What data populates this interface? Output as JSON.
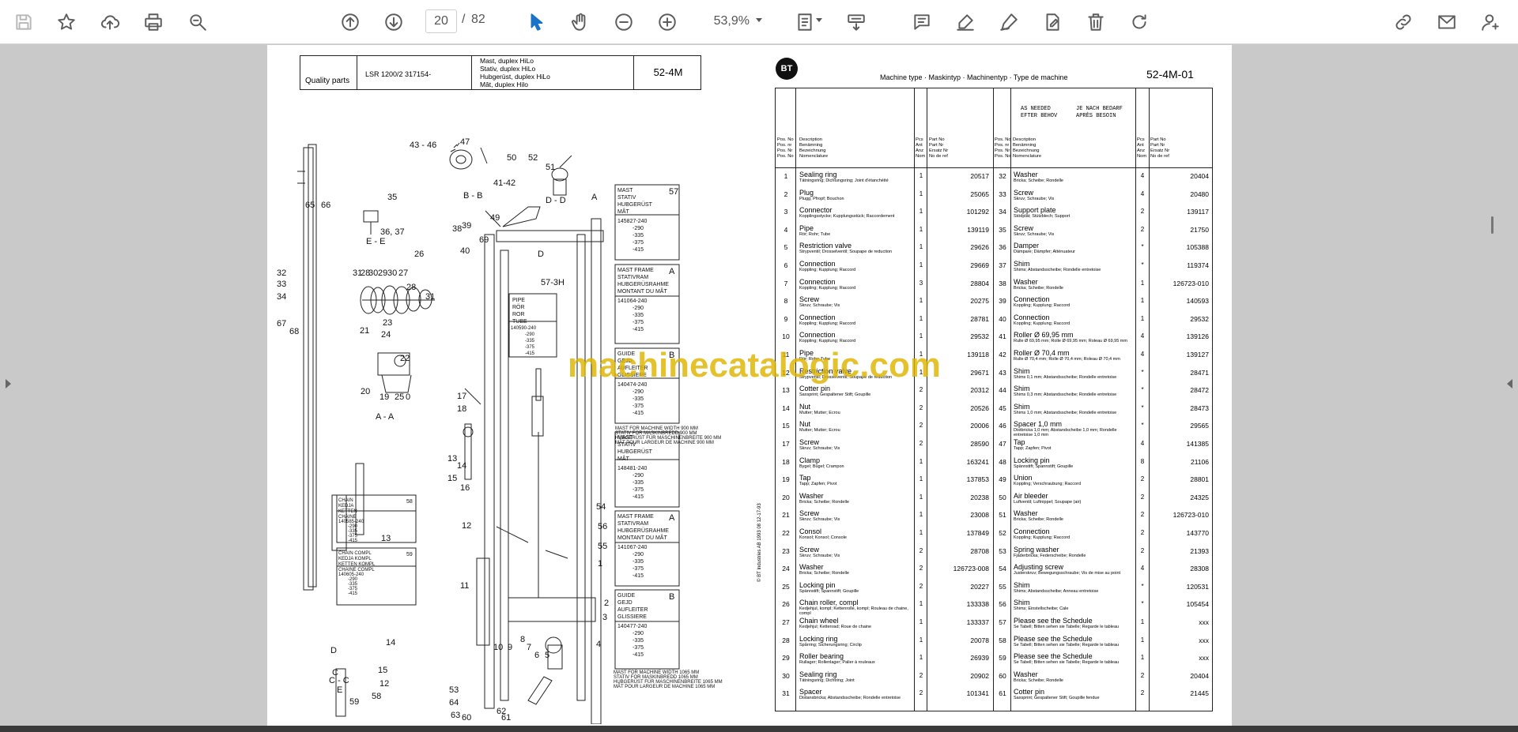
{
  "toolbar": {
    "buttons": [
      "save-icon",
      "bookmark-star-icon",
      "upload-cloud-icon",
      "print-icon",
      "zoom-search-icon",
      "page-up-icon",
      "page-down-icon",
      "select-arrow-icon",
      "hand-pan-icon",
      "zoom-out-icon",
      "zoom-in-icon",
      "fit-page-icon",
      "scroll-mode-icon",
      "comment-icon",
      "highlight-pen-icon",
      "sign-icon",
      "edit-pdf-icon",
      "delete-icon",
      "redo-icon",
      "share-link-icon",
      "email-icon",
      "account-icon"
    ],
    "page_current": "20",
    "page_separator": "/",
    "page_total": "82",
    "zoom": "53,9%"
  },
  "left_page": {
    "header": {
      "brand": "Quality parts",
      "model": "LSR 1200/2 317154-",
      "title_lines": [
        "Mast, duplex HiLo",
        "Stativ, duplex HiLo",
        "Hubgerüst, duplex HiLo",
        "Mât, duplex Hilo"
      ],
      "code": "52-4M"
    },
    "callouts": [
      "43 - 46",
      "47",
      "50",
      "52",
      "51",
      "41-42",
      "B - B",
      "D - D",
      "A",
      "35",
      "65",
      "66",
      "36, 37",
      "E - E",
      "26",
      "31",
      "28",
      "30",
      "29",
      "30",
      "27",
      "28",
      "31",
      "32",
      "33",
      "34",
      "67",
      "68",
      "23",
      "24",
      "21",
      "22",
      "20",
      "19",
      "25",
      "0",
      "A - A",
      "38",
      "39",
      "49",
      "69",
      "40",
      "D",
      "57-3H",
      "17",
      "18",
      "13",
      "14",
      "15",
      "16",
      "12",
      "11",
      "10",
      "9",
      "8",
      "7",
      "6",
      "5",
      "4",
      "3",
      "2",
      "1",
      "55",
      "56",
      "54",
      "53",
      "64",
      "63",
      "60",
      "61",
      "62",
      "13",
      "14",
      "15",
      "12",
      "58",
      "59",
      "E",
      "C",
      "C - C",
      "D"
    ],
    "boxes": [
      {
        "lines": [
          "MAST",
          "STATIV",
          "HUBGERÜST",
          "MÂT"
        ],
        "num": "57",
        "values": [
          "145827-240",
          "-290",
          "-335",
          "-375",
          "-415"
        ]
      },
      {
        "lines": [
          "MAST FRAME",
          "STATIVRAM",
          "HUBGERÜSRAHME",
          "MONTANT DU MÂT"
        ],
        "num": "A",
        "values": [
          "141064-240",
          "-290",
          "-335",
          "-375",
          "-415"
        ]
      },
      {
        "lines": [
          "GUIDE",
          "GEJD",
          "AUFLEITER",
          "GLISSIERE"
        ],
        "num": "B",
        "values": [
          "140474-240",
          "-290",
          "-335",
          "-375",
          "-415"
        ]
      },
      {
        "lines": [
          "MAST",
          "STATIV",
          "HUBGERÜST",
          "MÂT"
        ],
        "num": "",
        "values": [
          "148481-240",
          "-290",
          "-335",
          "-375",
          "-415"
        ]
      },
      {
        "lines": [
          "MAST FRAME",
          "STATIVRAM",
          "HUBGERÜSRAHME",
          "MONTANT DU MÂT"
        ],
        "num": "A",
        "values": [
          "141067-240",
          "-290",
          "-335",
          "-375",
          "-415"
        ]
      },
      {
        "lines": [
          "GUIDE",
          "GEJD",
          "AUFLEITER",
          "GLISSIERE"
        ],
        "num": "B",
        "values": [
          "140477-240",
          "-290",
          "-335",
          "-375",
          "-415"
        ]
      }
    ],
    "pipe_box": {
      "lines": [
        "PIPE",
        "RÖR",
        "ROR",
        "TUBE"
      ],
      "values": [
        "140590-240",
        "-290",
        "-335",
        "-375",
        "-415"
      ]
    },
    "notes": [
      "MAST FOR MACHINE WIDTH 900 MM",
      "STATIV FOR MASKINBREDD 900 MM",
      "HUBGERÜST FÜR MASCHINENBREITE 900 MM",
      "MÂT POUR LARGEUR DE MACHINE 900 MM",
      "MAST FOR MACHINE WIDTH 1065 MM",
      "STATIV FOR MASKINBREDD 1065 MM",
      "HUBGERÜST FÜR MASCHINENBREITE 1065 MM",
      "MÂT POUR LARGEUR DE MACHINE 1065 MM"
    ],
    "chain_box": {
      "lines": [
        "CHAIN",
        "KEDJA",
        "KETTEN",
        "CHAINE"
      ],
      "num": "58",
      "values": [
        "140585-240",
        "-290",
        "-335",
        "-375",
        "-415"
      ]
    },
    "chain_compl_box": {
      "lines": [
        "CHAIN COMPL",
        "KEDJA KOMPL",
        "KETTEN KOMPL",
        "CHAINE COMPL"
      ],
      "num": "59",
      "values": [
        "140605-240",
        "-290",
        "-335",
        "-375",
        "-415"
      ]
    }
  },
  "right_page": {
    "logo": "BT",
    "title": "Machine type · Maskintyp · Machinentyp · Type de machine",
    "code": "52-4M-01",
    "as_needed": [
      "AS NEEDED",
      "EFTER BEHOV"
    ],
    "je_nach": [
      "JE NACH BEDARF",
      "APRÈS BESOIN"
    ],
    "headers": {
      "pos": [
        "Pos. No",
        "Pos. nr",
        "Pos. Nr",
        "Pos. No"
      ],
      "desc": [
        "Description",
        "Benämning",
        "Bezeichnung",
        "Nomenclature"
      ],
      "qty": [
        "Pcs",
        "Ant",
        "Anz",
        "Nom"
      ],
      "part": [
        "Part No",
        "Part Nr",
        "Ersatz Nr",
        "No de ref"
      ]
    },
    "left_rows": [
      {
        "pos": "1",
        "name": "Sealing ring",
        "sub": "Tätningsring; Dichtungsring; Joint d'étanchéité",
        "qty": "1",
        "part": "20517"
      },
      {
        "pos": "2",
        "name": "Plug",
        "sub": "Plugg; Pfropf; Bouchon",
        "qty": "1",
        "part": "25065"
      },
      {
        "pos": "3",
        "name": "Connector",
        "sub": "Kopplingsstycke; Kupplungsstück; Raccordement",
        "qty": "1",
        "part": "101292"
      },
      {
        "pos": "4",
        "name": "Pipe",
        "sub": "Rör; Rohr; Tube",
        "qty": "1",
        "part": "139119"
      },
      {
        "pos": "5",
        "name": "Restriction valve",
        "sub": "Strypventil; Drosselventil; Soupape de reduction",
        "qty": "1",
        "part": "29626"
      },
      {
        "pos": "6",
        "name": "Connection",
        "sub": "Koppling; Kupplung; Raccord",
        "qty": "1",
        "part": "29669"
      },
      {
        "pos": "7",
        "name": "Connection",
        "sub": "Koppling; Kupplung; Raccord",
        "qty": "3",
        "part": "28804"
      },
      {
        "pos": "8",
        "name": "Screw",
        "sub": "Skruv; Schraube; Vis",
        "qty": "1",
        "part": "20275"
      },
      {
        "pos": "9",
        "name": "Connection",
        "sub": "Koppling; Kupplung; Raccord",
        "qty": "1",
        "part": "28781"
      },
      {
        "pos": "10",
        "name": "Connection",
        "sub": "Koppling; Kupplung; Raccord",
        "qty": "1",
        "part": "29532"
      },
      {
        "pos": "11",
        "name": "Pipe",
        "sub": "Rör; Rohr; Tube",
        "qty": "1",
        "part": "139118"
      },
      {
        "pos": "12",
        "name": "Restriction valve",
        "sub": "Strypventil; Drosselventil; Soupape de reduction",
        "qty": "1",
        "part": "29671"
      },
      {
        "pos": "13",
        "name": "Cotter pin",
        "sub": "Saxsprint; Gespaltener Stift; Goupille",
        "qty": "2",
        "part": "20312"
      },
      {
        "pos": "14",
        "name": "Nut",
        "sub": "Mutter; Mutter; Ecrou",
        "qty": "2",
        "part": "20526"
      },
      {
        "pos": "15",
        "name": "Nut",
        "sub": "Mutter; Mutter; Ecrou",
        "qty": "2",
        "part": "20006"
      },
      {
        "pos": "17",
        "name": "Screw",
        "sub": "Skruv; Schraube; Vis",
        "qty": "2",
        "part": "28590"
      },
      {
        "pos": "18",
        "name": "Clamp",
        "sub": "Bygel; Bügel; Crampon",
        "qty": "1",
        "part": "163241"
      },
      {
        "pos": "19",
        "name": "Tap",
        "sub": "Tapp; Zapfen; Pivot",
        "qty": "1",
        "part": "137853"
      },
      {
        "pos": "20",
        "name": "Washer",
        "sub": "Bricka; Scheibe; Rondelle",
        "qty": "1",
        "part": "20238"
      },
      {
        "pos": "21",
        "name": "Screw",
        "sub": "Skruv; Schraube; Vis",
        "qty": "1",
        "part": "23008"
      },
      {
        "pos": "22",
        "name": "Consol",
        "sub": "Konsol; Konsol; Console",
        "qty": "1",
        "part": "137849"
      },
      {
        "pos": "23",
        "name": "Screw",
        "sub": "Skruv; Schraube; Vis",
        "qty": "2",
        "part": "28708"
      },
      {
        "pos": "24",
        "name": "Washer",
        "sub": "Bricka; Scheibe; Rondelle",
        "qty": "2",
        "part": "126723-008"
      },
      {
        "pos": "25",
        "name": "Locking pin",
        "sub": "Spännstift; Spannstift; Goupille",
        "qty": "2",
        "part": "20227"
      },
      {
        "pos": "26",
        "name": "Chain roller, compl",
        "sub": "Kedjehjul, kompl; Kettenrolle, kompl; Rouleau de chaine, compl",
        "qty": "1",
        "part": "133338"
      },
      {
        "pos": "27",
        "name": "Chain wheel",
        "sub": "Kedjehjul; Kettenrad; Roue de chaine",
        "qty": "1",
        "part": "133337"
      },
      {
        "pos": "28",
        "name": "Locking ring",
        "sub": "Spårring; Sicherungsring; Circlip",
        "qty": "1",
        "part": "20078"
      },
      {
        "pos": "29",
        "name": "Roller bearing",
        "sub": "Rullager; Rollenlager; Palier à rouleaux",
        "qty": "1",
        "part": "26939"
      },
      {
        "pos": "30",
        "name": "Sealing ring",
        "sub": "Tätningsring; Dichtring; Joint",
        "qty": "2",
        "part": "20902"
      },
      {
        "pos": "31",
        "name": "Spacer",
        "sub": "Distansbricka; Abstandsscheibe; Rondelle entretoise",
        "qty": "2",
        "part": "101341"
      }
    ],
    "right_rows": [
      {
        "pos": "32",
        "name": "Washer",
        "sub": "Bricka; Scheibe; Rondelle",
        "qty": "4",
        "part": "20404"
      },
      {
        "pos": "33",
        "name": "Screw",
        "sub": "Skruv; Schraube; Vis",
        "qty": "4",
        "part": "20480"
      },
      {
        "pos": "34",
        "name": "Support plate",
        "sub": "Stödplåt; Stützblech; Support",
        "qty": "2",
        "part": "139117"
      },
      {
        "pos": "35",
        "name": "Screw",
        "sub": "Skruv; Schraube; Vis",
        "qty": "2",
        "part": "21750"
      },
      {
        "pos": "36",
        "name": "Damper",
        "sub": "Dämpare; Dämpfer; Atténuateur",
        "qty": "*",
        "part": "105388"
      },
      {
        "pos": "37",
        "name": "Shim",
        "sub": "Shims; Abstandsscheibe; Rondelle entretoise",
        "qty": "*",
        "part": "119374"
      },
      {
        "pos": "38",
        "name": "Washer",
        "sub": "Bricka; Scheibe; Rondelle",
        "qty": "1",
        "part": "126723-010"
      },
      {
        "pos": "39",
        "name": "Connection",
        "sub": "Koppling; Kupplung; Raccord",
        "qty": "1",
        "part": "140593"
      },
      {
        "pos": "40",
        "name": "Connection",
        "sub": "Koppling; Kupplung; Raccord",
        "qty": "1",
        "part": "29532"
      },
      {
        "pos": "41",
        "name": "Roller Ø 69,95 mm",
        "sub": "Rulle Ø 69,95 mm; Rolle Ø 69,95 mm; Roleau Ø 69,95 mm",
        "qty": "4",
        "part": "139126"
      },
      {
        "pos": "42",
        "name": "Roller Ø 70,4 mm",
        "sub": "Rulle Ø 70,4 mm; Rolle Ø 70,4 mm; Roleau Ø 70,4 mm",
        "qty": "4",
        "part": "139127"
      },
      {
        "pos": "43",
        "name": "Shim",
        "sub": "Shims 0,1 mm; Abstandsscheibe; Rondelle entretoise",
        "qty": "*",
        "part": "28471"
      },
      {
        "pos": "44",
        "name": "Shim",
        "sub": "Shims 0,3 mm; Abstandsscheibe; Rondelle entretoise",
        "qty": "*",
        "part": "28472"
      },
      {
        "pos": "45",
        "name": "Shim",
        "sub": "Shims 1,0 mm; Abstandsscheibe; Rondelle entretoise",
        "qty": "*",
        "part": "28473"
      },
      {
        "pos": "46",
        "name": "Spacer 1,0 mm",
        "sub": "Distbricka 1,0 mm; Abstandscheibe 1,0 mm; Rondelle entretoise 1,0 mm",
        "qty": "*",
        "part": "29565"
      },
      {
        "pos": "47",
        "name": "Tap",
        "sub": "Tapp; Zapfen; Pivot",
        "qty": "4",
        "part": "141385"
      },
      {
        "pos": "48",
        "name": "Locking pin",
        "sub": "Spännstift; Spannstift; Goupille",
        "qty": "8",
        "part": "21106"
      },
      {
        "pos": "49",
        "name": "Union",
        "sub": "Koppling; Verschraubung; Raccord",
        "qty": "2",
        "part": "28801"
      },
      {
        "pos": "50",
        "name": "Air bleeder",
        "sub": "Luftventil; Luftnippel; Soupape (air)",
        "qty": "2",
        "part": "24325"
      },
      {
        "pos": "51",
        "name": "Washer",
        "sub": "Bricka; Scheibe; Rondelle",
        "qty": "2",
        "part": "126723-010"
      },
      {
        "pos": "52",
        "name": "Connection",
        "sub": "Koppling; Kupplung; Raccord",
        "qty": "2",
        "part": "143770"
      },
      {
        "pos": "53",
        "name": "Spring washer",
        "sub": "Fjäderbricka; Federscheibe; Rondelle",
        "qty": "2",
        "part": "21393"
      },
      {
        "pos": "54",
        "name": "Adjusting screw",
        "sub": "Justerskruv; Bewegungsschraube; Vis de mise au point",
        "qty": "4",
        "part": "28308"
      },
      {
        "pos": "55",
        "name": "Shim",
        "sub": "Shims; Abstandsscheibe; Anneau entretoise",
        "qty": "*",
        "part": "120531"
      },
      {
        "pos": "56",
        "name": "Shim",
        "sub": "Shims; Einstellscheibe; Cale",
        "qty": "*",
        "part": "105454"
      },
      {
        "pos": "57",
        "name": "Please see the Schedule",
        "sub": "Se Tabell; Bitten sehen sie Tabelle; Regarde le tableau",
        "qty": "1",
        "part": "xxx"
      },
      {
        "pos": "58",
        "name": "Please see the Schedule",
        "sub": "Se Tabell; Bitten sehen sie Tabelle; Regarde le tableau",
        "qty": "1",
        "part": "xxx"
      },
      {
        "pos": "59",
        "name": "Please see the Schedule",
        "sub": "Se Tabell; Bitten sehen sie Tabelle; Regarde le tableau",
        "qty": "1",
        "part": "xxx"
      },
      {
        "pos": "60",
        "name": "Washer",
        "sub": "Bricka; Scheibe; Rondelle",
        "qty": "2",
        "part": "20404"
      },
      {
        "pos": "61",
        "name": "Cotter pin",
        "sub": "Saxsprint; Gespaltener Stift; Goupille fendue",
        "qty": "2",
        "part": "21445"
      }
    ],
    "side_note": "© BT Industries AB   1993 08   12-17-93"
  },
  "watermark": "machinecatalogic.com",
  "colors": {
    "watermark": "#dcb200",
    "toolbar_icon": "#5c5c5c",
    "active_icon": "#1a73c8",
    "background": "#c9c9c9"
  }
}
